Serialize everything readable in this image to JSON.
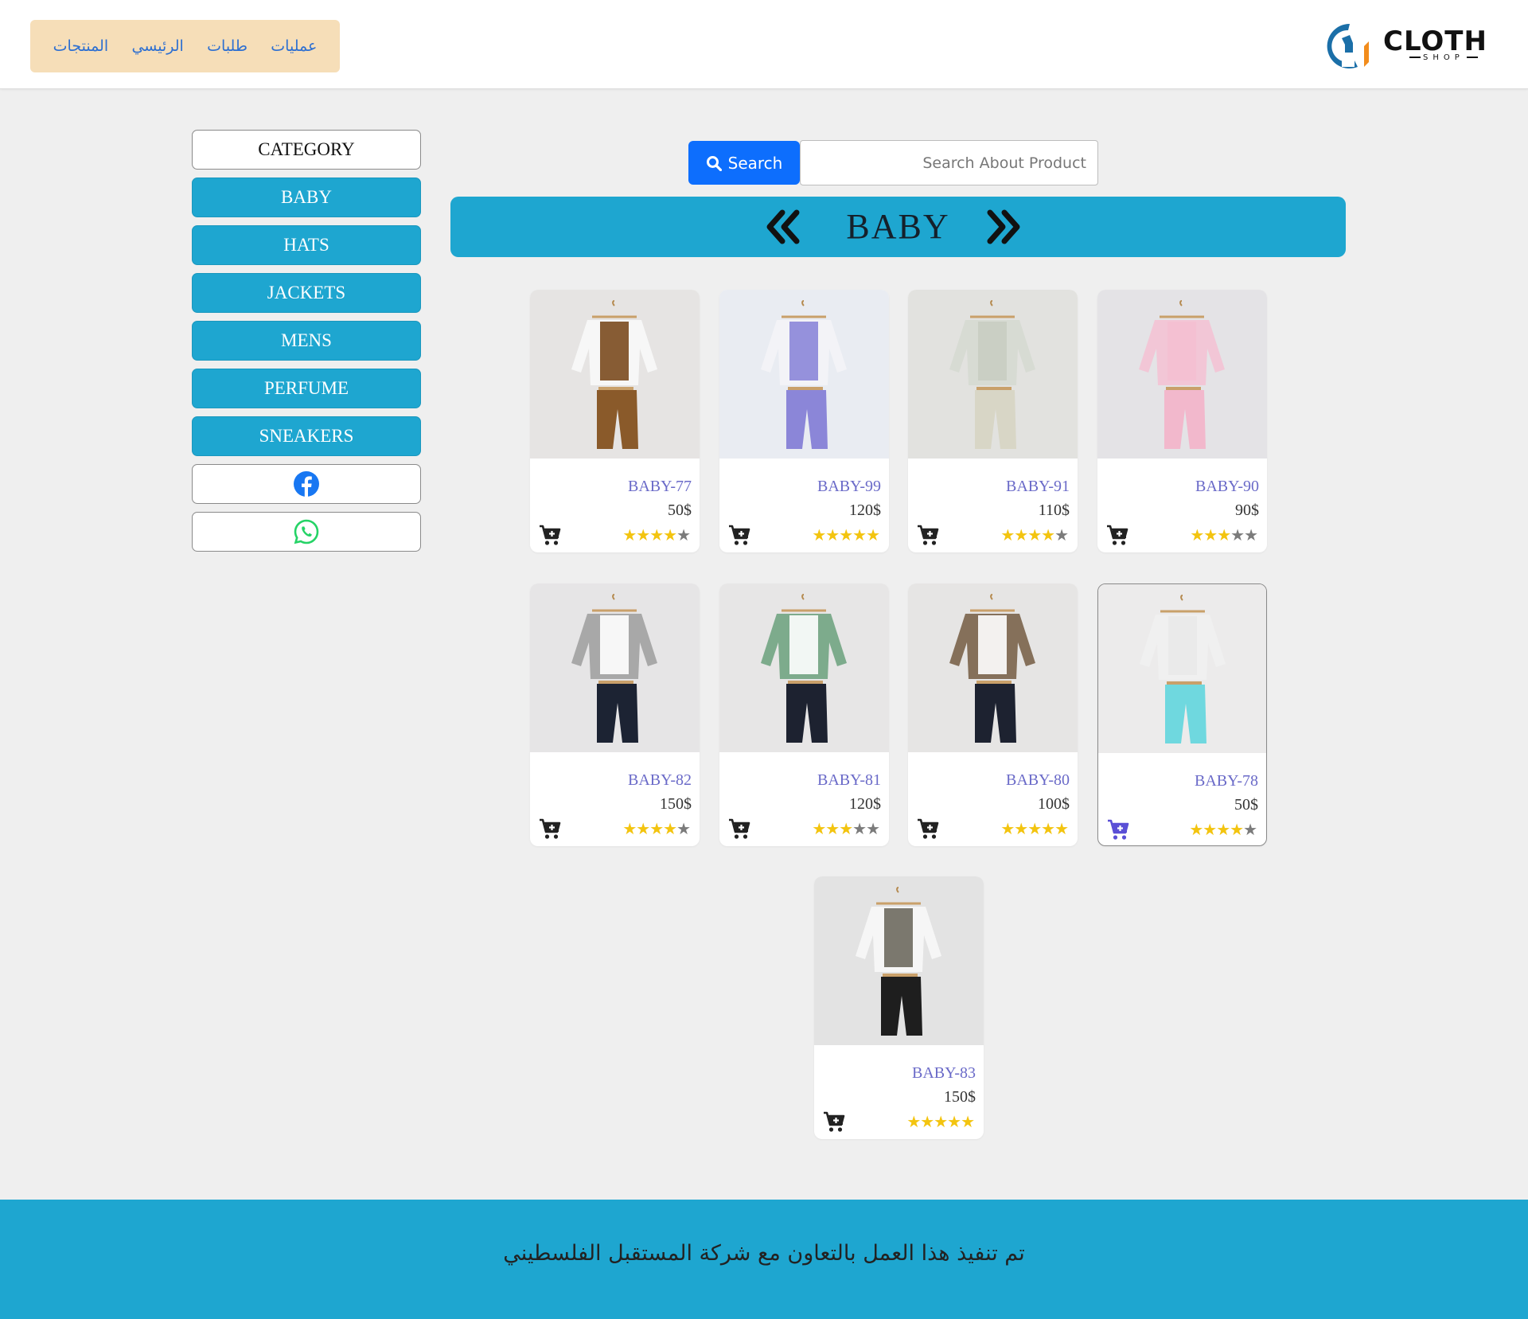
{
  "nav": {
    "items": [
      {
        "label": "عمليات"
      },
      {
        "label": "طلبات"
      },
      {
        "label": "الرئيسي"
      },
      {
        "label": "المنتجات"
      }
    ],
    "background": "#f6deb8",
    "link_color": "#2d6fd1"
  },
  "logo": {
    "text": "CLOTH",
    "subtext": "SHOP"
  },
  "sidebar": {
    "header": "CATEGORY",
    "categories": [
      {
        "label": "BABY"
      },
      {
        "label": "HATS"
      },
      {
        "label": "JACKETS"
      },
      {
        "label": "MENS"
      },
      {
        "label": "PERFUME"
      },
      {
        "label": "SNEAKERS"
      }
    ],
    "social": [
      "facebook-icon",
      "whatsapp-icon"
    ],
    "accent": "#1ea6d0"
  },
  "search": {
    "button_label": "Search",
    "placeholder": "Search About Product",
    "button_color": "#0d6efd"
  },
  "banner": {
    "title": "BABY"
  },
  "products": [
    {
      "name": "BABY-77",
      "price": "50$",
      "rating": 4,
      "image": "brown vest outfit"
    },
    {
      "name": "BABY-99",
      "price": "120$",
      "rating": 5,
      "image": "purple overalls"
    },
    {
      "name": "BABY-91",
      "price": "110$",
      "rating": 4,
      "image": "green polo set with hat"
    },
    {
      "name": "BABY-90",
      "price": "90$",
      "rating": 3,
      "image": "pink knit romper"
    },
    {
      "name": "BABY-82",
      "price": "150$",
      "rating": 4,
      "image": "grey jacket navy pants"
    },
    {
      "name": "BABY-81",
      "price": "120$",
      "rating": 3,
      "image": "green jacket navy pants"
    },
    {
      "name": "BABY-80",
      "price": "100$",
      "rating": 5,
      "image": "brown jacket navy pants"
    },
    {
      "name": "BABY-78",
      "price": "50$",
      "rating": 4,
      "image": "striped shirt turquoise pants"
    },
    {
      "name": "BABY-83",
      "price": "150$",
      "rating": 5,
      "image": "patterned vest black pants"
    }
  ],
  "footer": {
    "text": "تم تنفيذ هذا العمل بالتعاون مع شركة المستقبل الفلسطيني"
  }
}
